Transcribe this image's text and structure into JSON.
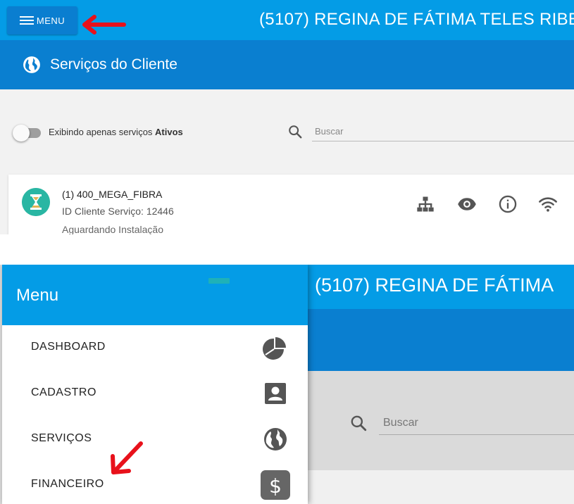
{
  "top_screen": {
    "menu_button_label": "MENU",
    "client_title": "(5107) REGINA DE FÁTIMA TELES RIBE",
    "section_title": "Serviços do Cliente",
    "filter_prefix": "Exibindo apenas serviços ",
    "filter_strong": "Ativos",
    "search_placeholder": "Buscar",
    "service": {
      "name": "(1) 400_MEGA_FIBRA",
      "id_line": "ID Cliente Serviço: 12446",
      "status": "Aguardando Instalação"
    },
    "action_icons": [
      "network-icon",
      "eye-icon",
      "info-icon",
      "wifi-icon"
    ]
  },
  "bottom_screen": {
    "client_title": "(5107) REGINA DE FÁTIMA",
    "drawer_title": "Menu",
    "search_placeholder": "Buscar",
    "menu_items": [
      {
        "label": "DASHBOARD",
        "icon": "pie-chart-icon"
      },
      {
        "label": "CADASTRO",
        "icon": "contact-card-icon"
      },
      {
        "label": "SERVIÇOS",
        "icon": "globe-icon"
      },
      {
        "label": "FINANCEIRO",
        "icon": "dollar-icon"
      }
    ]
  },
  "colors": {
    "primary_light": "#049ce6",
    "primary_dark": "#0a7fd0",
    "annotation_red": "#e8111b",
    "hourglass_teal": "#29b6a3"
  }
}
